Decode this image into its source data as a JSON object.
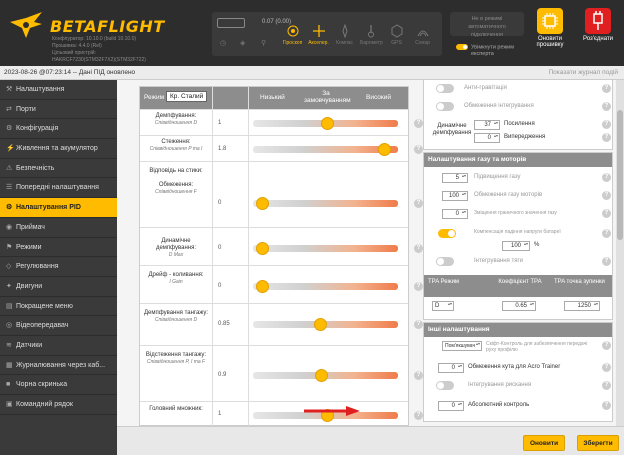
{
  "header": {
    "logo": "BETAFLIGHT",
    "info_lines": [
      "Конфігуратор: 10.10.0 (build 10.10.0)",
      "Прошивка: 4.4.0 (Rel)",
      "Цільовий пристрій:",
      "HAKRCF7230(STM32F7X2)(STM32F722)"
    ],
    "battery_text": "0.07 (0.00)",
    "sensors": [
      {
        "name": "Гіроскоп",
        "on": true
      },
      {
        "name": "Акселер.",
        "on": true
      },
      {
        "name": "Компас",
        "on": false
      },
      {
        "name": "Барометр",
        "on": false
      },
      {
        "name": "GPS",
        "on": false
      },
      {
        "name": "Сонар",
        "on": false
      }
    ],
    "port_info": [
      "Не в режимі",
      "автоматичного",
      "підключення"
    ],
    "expert_mode": [
      "Увімкнути режим",
      "експерта"
    ],
    "update_firmware": [
      "Оновити",
      "прошивку"
    ],
    "disconnect": "Роз'єднати"
  },
  "statusline": {
    "text": "2023-08-26 @07:23:14 -- Дані ПІД оновлено",
    "right": "Показати журнал подій"
  },
  "sidebar": {
    "items": [
      {
        "label": "Налаштування",
        "icon": "⚒"
      },
      {
        "label": "Порти",
        "icon": "⇄"
      },
      {
        "label": "Конфігурація",
        "icon": "⚙"
      },
      {
        "label": "Живлення та акумулятор",
        "icon": "⚡"
      },
      {
        "label": "Безпечність",
        "icon": "⚠"
      },
      {
        "label": "Попередні налаштування",
        "icon": "☰"
      },
      {
        "label": "Налаштування PID",
        "icon": "⚙",
        "active": true
      },
      {
        "label": "Приймач",
        "icon": "◉"
      },
      {
        "label": "Режими",
        "icon": "⚑"
      },
      {
        "label": "Регулювання",
        "icon": "◇"
      },
      {
        "label": "Двигуни",
        "icon": "✦"
      },
      {
        "label": "Покращене меню",
        "icon": "▤"
      },
      {
        "label": "Відеопередавач",
        "icon": "◎"
      },
      {
        "label": "Датчики",
        "icon": "≋"
      },
      {
        "label": "Журналювання через каб...",
        "icon": "▦"
      },
      {
        "label": "Чорна скринька",
        "icon": "■"
      },
      {
        "label": "Командний рядок",
        "icon": "▣"
      }
    ]
  },
  "sliders_panel": {
    "mode_label": "Режим",
    "mode_value": "Кр. Сталий",
    "col_low": "Низький",
    "col_default": "За замовчуванням",
    "col_high": "Високий",
    "rows": [
      {
        "label": "Демпфування:",
        "sub": "Співвідношення D",
        "value": "1",
        "level": 0.51
      },
      {
        "label": "Стеження:",
        "sub": "Співвідношення P та I",
        "value": "1.8",
        "level": 0.9
      },
      {
        "label": "Відповідь на стики:",
        "sub": "",
        "value": "",
        "level": null
      },
      {
        "label": "Обмеження:",
        "sub": "Співвідношення F",
        "value": "0",
        "level": 0.06
      },
      {
        "label": "Динамічне демпфування:",
        "sub": "D Max",
        "value": "0",
        "level": 0.06
      },
      {
        "label": "Дрейф - коливання:",
        "sub": "I Gain",
        "value": "0",
        "level": 0.06
      },
      {
        "label": "Демпфування тангажу:",
        "sub": "Співвідношення D",
        "value": "0.85",
        "level": 0.46
      },
      {
        "label": "Відстеження тангажу:",
        "sub": "Співвідношення P, I та F",
        "value": "0.9",
        "level": 0.47
      },
      {
        "label": "Головний множник:",
        "sub": "",
        "value": "1",
        "level": 0.51
      }
    ]
  },
  "right_top": {
    "rows": [
      {
        "label": "Анти-гравітація",
        "on": false
      },
      {
        "label": "Обмеження інтегрування",
        "on": false
      }
    ],
    "dyn_label": "Динамічне демпфування",
    "dyn_values": [
      "37",
      "0"
    ],
    "dyn_labels": [
      "Посилення",
      "Випередження"
    ]
  },
  "throttle_panel": {
    "title": "Налаштування газу та моторів",
    "rows": [
      {
        "value": "5",
        "label": "Підвищення газу",
        "unit": ""
      },
      {
        "value": "100",
        "label": "Обмеження газу моторів",
        "unit": ""
      },
      {
        "value": "0",
        "label": "Зміщення граничного значення газу",
        "unit": ""
      },
      {
        "value": "100",
        "label": "Компенсація падіння напруги батареї",
        "unit": "%"
      },
      {
        "value": "",
        "label": "Інтегрування тяги",
        "unit": ""
      }
    ],
    "tpa_headers": [
      "TPA Режим",
      "Коефіцієнт TPA",
      "TPA точка зупинки"
    ],
    "tpa_values": [
      "D",
      "0.65",
      "1250"
    ]
  },
  "other_panel": {
    "title": "Інші налаштування",
    "rows": [
      {
        "value": "Пом'якшувач",
        "label": "Скіфт-Контроль для забезпечення передачі руху профілю"
      },
      {
        "value": "0",
        "label": "Обмеження кута для Acro Trainer"
      },
      {
        "value": "",
        "label": "Інтегрування рискання"
      },
      {
        "value": "0",
        "label": "Абсолютний контроль"
      }
    ]
  },
  "footer": {
    "refresh": "Оновити",
    "save": "Зберегти"
  },
  "colors": {
    "accent": "#ffbb00",
    "header_bg": "#2d2d2d",
    "sidebar_bg": "#3a3a3a",
    "panel_head": "#8d8d8d",
    "arrow": "#e02020"
  }
}
